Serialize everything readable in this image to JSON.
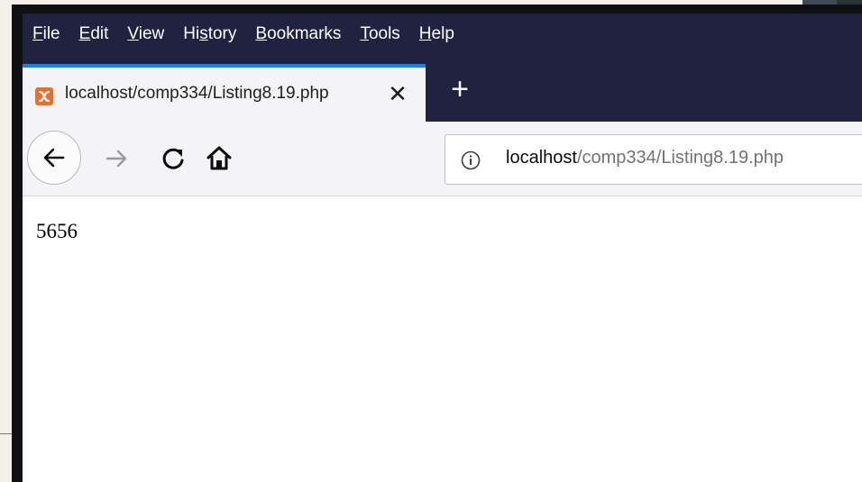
{
  "menubar": {
    "items": [
      {
        "pre": "",
        "ul": "F",
        "post": "ile"
      },
      {
        "pre": "",
        "ul": "E",
        "post": "dit"
      },
      {
        "pre": "",
        "ul": "V",
        "post": "iew"
      },
      {
        "pre": "Hi",
        "ul": "s",
        "post": "tory"
      },
      {
        "pre": "",
        "ul": "B",
        "post": "ookmarks"
      },
      {
        "pre": "",
        "ul": "T",
        "post": "ools"
      },
      {
        "pre": "",
        "ul": "H",
        "post": "elp"
      }
    ]
  },
  "tab": {
    "title": "localhost/comp334/Listing8.19.php",
    "close_glyph": "✕",
    "favicon": "xampp-icon"
  },
  "newtab": {
    "glyph": "+"
  },
  "navbar": {
    "icons": [
      "back-arrow-icon",
      "forward-arrow-icon",
      "reload-icon",
      "home-icon",
      "info-icon"
    ]
  },
  "urlbar": {
    "host": "localhost",
    "path": "/comp334/Listing8.19.php"
  },
  "page": {
    "text": "5656"
  },
  "colors": {
    "chrome_bg": "#202340",
    "tab_accent": "#0a84ff",
    "favicon": "#ee6d2a"
  }
}
